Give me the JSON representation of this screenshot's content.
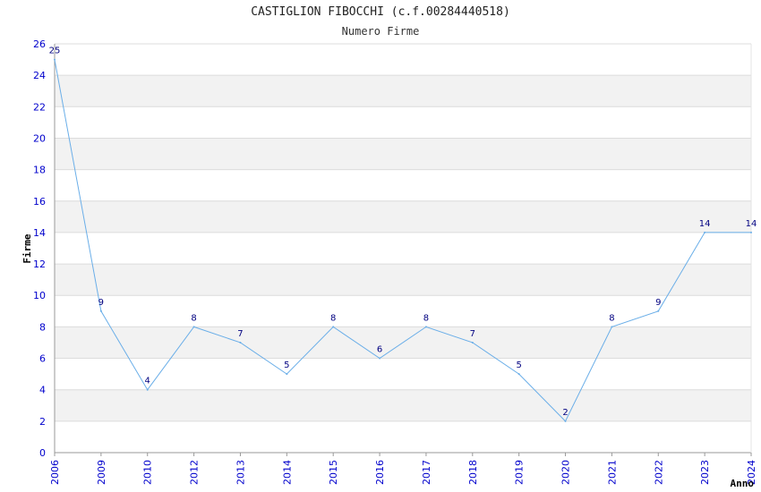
{
  "chart_data": {
    "type": "line",
    "title": "CASTIGLION FIBOCCHI (c.f.00284440518)",
    "subtitle": "Numero Firme",
    "xlabel": "Anno",
    "ylabel": "Firme",
    "categories": [
      "2006",
      "2009",
      "2010",
      "2012",
      "2013",
      "2014",
      "2015",
      "2016",
      "2017",
      "2018",
      "2019",
      "2020",
      "2021",
      "2022",
      "2023",
      "2024"
    ],
    "series": [
      {
        "values": [
          25,
          9,
          4,
          8,
          7,
          5,
          8,
          6,
          8,
          7,
          5,
          2,
          8,
          9,
          14,
          14
        ]
      }
    ],
    "ylim": [
      0,
      26
    ],
    "yticks": [
      0,
      2,
      4,
      6,
      8,
      10,
      12,
      14,
      16,
      18,
      20,
      22,
      24,
      26
    ],
    "grid": true,
    "colors": {
      "line": "#6aaee8",
      "band": "#f2f2f2",
      "gridline": "#dcdcdc",
      "axis": "#999999",
      "tick": "#0000cc",
      "data_label": "#000080"
    }
  }
}
